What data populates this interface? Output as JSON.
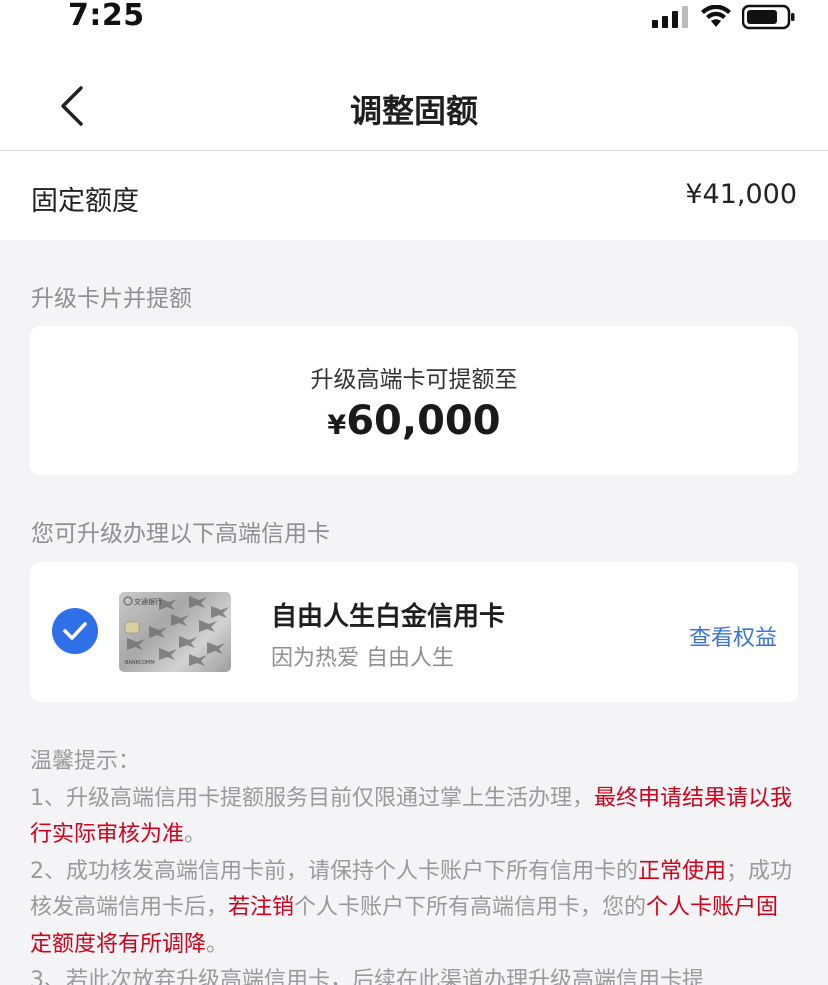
{
  "status": {
    "time": "7:25"
  },
  "nav": {
    "title": "调整固额",
    "back_icon": "chevron-left-icon"
  },
  "fixed_limit": {
    "label": "固定额度",
    "value": "¥41,000"
  },
  "upgrade_section": {
    "label": "升级卡片并提额",
    "caption": "升级高端卡可提额至",
    "currency": "¥",
    "amount": "60,000"
  },
  "cards_section": {
    "label": "您可升级办理以下高端信用卡",
    "card": {
      "name": "自由人生白金信用卡",
      "slogan": "因为热爱 自由人生",
      "link": "查看权益",
      "selected": true,
      "logo_text": "交通银行",
      "card_text": "BANKCOMM"
    }
  },
  "tips": {
    "title": "温馨提示：",
    "item1_a": "1、升级高端信用卡提额服务目前仅限通过掌上生活办理，",
    "item1_red": "最终申请结果请以我行实际审核为准",
    "item1_b": "。",
    "item2_a": "2、成功核发高端信用卡前，请保持个人卡账户下所有信用卡的",
    "item2_red1": "正常使用",
    "item2_b": "；成功核发高端信用卡后，",
    "item2_red2": "若注销",
    "item2_c": "个人卡账户下所有高端信用卡，您的",
    "item2_red3": "个人卡账户固定额度将有所调降",
    "item2_d": "。",
    "item3": "3、若此次放弃升级高端信用卡，后续在此渠道办理升级高端信用卡提"
  },
  "colors": {
    "accent": "#2f6fe8",
    "link": "#3b74d6",
    "warning": "#d0021b"
  }
}
